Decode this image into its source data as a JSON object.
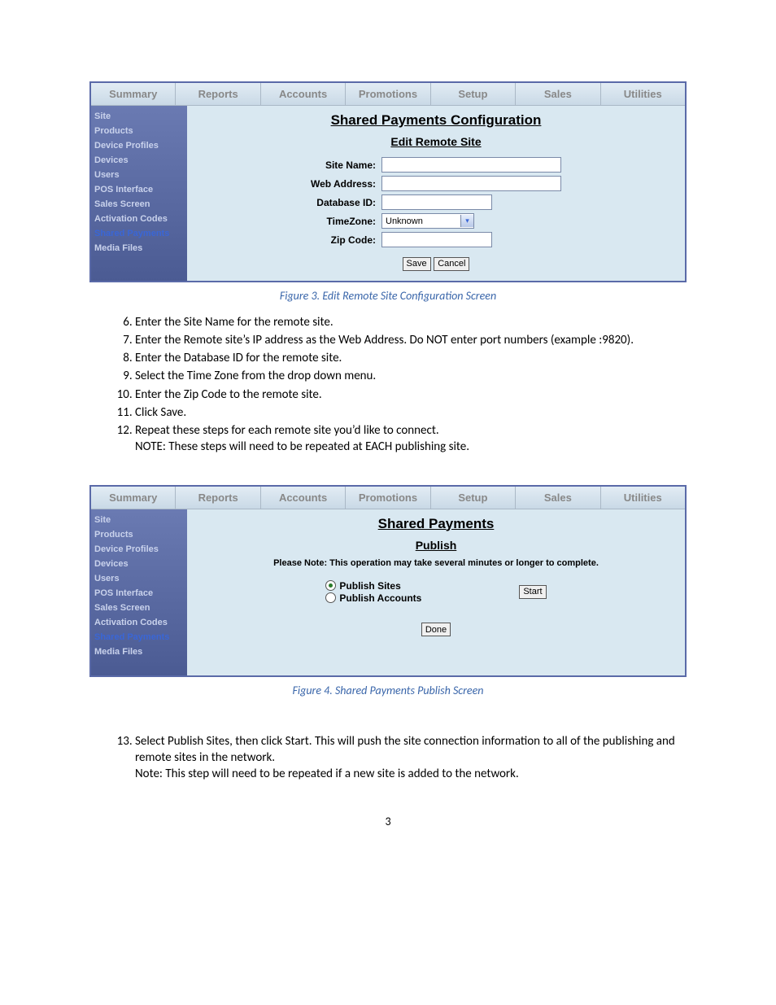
{
  "tabs": [
    "Summary",
    "Reports",
    "Accounts",
    "Promotions",
    "Setup",
    "Sales",
    "Utilities"
  ],
  "sidebar": [
    "Site",
    "Products",
    "Device Profiles",
    "Devices",
    "Users",
    "POS Interface",
    "Sales Screen",
    "Activation Codes",
    "Shared Payments",
    "Media Files"
  ],
  "fig3": {
    "title": "Shared Payments Configuration",
    "subtitle": "Edit Remote Site",
    "labels": {
      "siteName": "Site Name:",
      "webAddress": "Web Address:",
      "databaseId": "Database ID:",
      "timeZone": "TimeZone:",
      "zipCode": "Zip Code:"
    },
    "timeZoneValue": "Unknown",
    "save": "Save",
    "cancel": "Cancel",
    "caption": "Figure 3. Edit Remote Site Configuration Screen"
  },
  "steps1": {
    "s6": "Enter the Site Name for the remote site.",
    "s7": "Enter the Remote site’s IP address as the Web Address.  Do NOT enter port numbers (example  :9820).",
    "s8": "Enter the Database ID for the remote site.",
    "s9": "Select the Time Zone from the drop down menu.",
    "s10": " Enter the Zip Code to the remote site.",
    "s11": "Click Save.",
    "s12": "Repeat these steps for each remote site you’d like to connect.",
    "s12note": "NOTE: These steps will need to be repeated at EACH publishing site."
  },
  "fig4": {
    "title": "Shared Payments",
    "subtitle": "Publish",
    "note": "Please Note: This operation may take several minutes or longer to complete.",
    "radio1": "Publish Sites",
    "radio2": "Publish Accounts",
    "start": "Start",
    "done": "Done",
    "caption": "Figure 4. Shared Payments Publish Screen"
  },
  "steps2": {
    "s13": "Select Publish Sites, then click Start. This will push the site connection information to all of the publishing and remote sites in the network.",
    "s13note": "Note: This step will need to be repeated if a new site is added to the network."
  },
  "pageNum": "3"
}
